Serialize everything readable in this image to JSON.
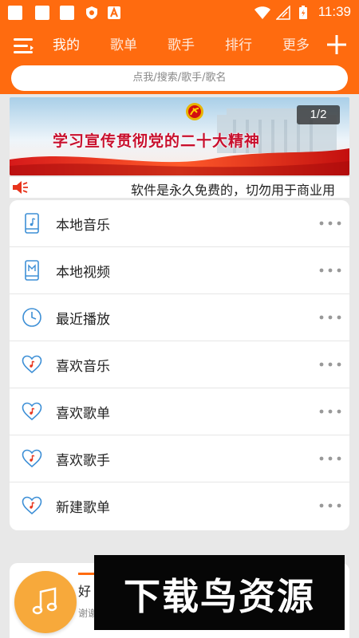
{
  "status_bar": {
    "time": "11:39"
  },
  "header": {
    "tabs": [
      {
        "label": "我的"
      },
      {
        "label": "歌单"
      },
      {
        "label": "歌手"
      },
      {
        "label": "排行"
      },
      {
        "label": "更多"
      }
    ],
    "active_tab": "我的"
  },
  "search": {
    "placeholder": "点我/搜索/歌手/歌名"
  },
  "banner": {
    "title": "学习宣传贯彻党的二十大精神",
    "counter": "1/2"
  },
  "notice": {
    "text": "软件是永久免费的，切勿用于商业用"
  },
  "menu": {
    "items": [
      {
        "label": "本地音乐",
        "icon": "phone-music-icon"
      },
      {
        "label": "本地视频",
        "icon": "phone-video-icon"
      },
      {
        "label": "最近播放",
        "icon": "clock-icon"
      },
      {
        "label": "喜欢音乐",
        "icon": "heart-music-icon"
      },
      {
        "label": "喜欢歌单",
        "icon": "heart-music-icon"
      },
      {
        "label": "喜欢歌手",
        "icon": "heart-music-icon"
      },
      {
        "label": "新建歌单",
        "icon": "heart-music-icon"
      }
    ]
  },
  "player": {
    "title": "好",
    "subtitle": "谢谢"
  },
  "watermark": {
    "text": "下载鸟资源"
  },
  "colors": {
    "accent": "#ff6b0f",
    "icon_blue": "#3d8fd6",
    "banner_red": "#c8102e",
    "disc": "#f7a93b"
  }
}
